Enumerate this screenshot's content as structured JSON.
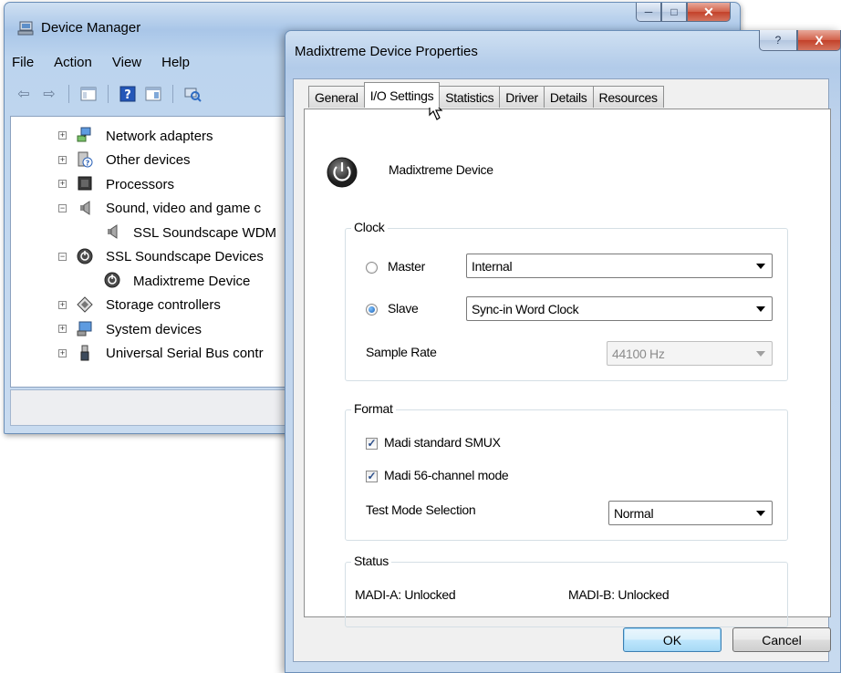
{
  "device_manager": {
    "title": "Device Manager",
    "menu": [
      "File",
      "Action",
      "View",
      "Help"
    ],
    "tree": [
      {
        "label": "Network adapters",
        "icon": "network-icon",
        "expander": "+"
      },
      {
        "label": "Other devices",
        "icon": "unknown-device-icon",
        "expander": "+"
      },
      {
        "label": "Processors",
        "icon": "processor-icon",
        "expander": "+"
      },
      {
        "label": "Sound, video and game c",
        "icon": "speaker-icon",
        "expander": "-"
      },
      {
        "label": "SSL Soundscape WDM",
        "icon": "speaker-icon",
        "expander": ""
      },
      {
        "label": "SSL Soundscape Devices",
        "icon": "power-knob-icon",
        "expander": "-"
      },
      {
        "label": "Madixtreme Device",
        "icon": "power-knob-icon",
        "expander": ""
      },
      {
        "label": "Storage controllers",
        "icon": "storage-icon",
        "expander": "+"
      },
      {
        "label": "System devices",
        "icon": "system-icon",
        "expander": "+"
      },
      {
        "label": "Universal Serial Bus contr",
        "icon": "usb-icon",
        "expander": "+"
      }
    ]
  },
  "properties": {
    "title": "Madixtreme Device Properties",
    "help_glyph": "?",
    "close_glyph": "X",
    "tabs": [
      "General",
      "I/O Settings",
      "Statistics",
      "Driver",
      "Details",
      "Resources"
    ],
    "active_tab": "I/O Settings",
    "device_name": "Madixtreme Device",
    "clock": {
      "title": "Clock",
      "master_label": "Master",
      "master_value": "Internal",
      "slave_label": "Slave",
      "slave_value": "Sync-in Word Clock",
      "selected": "Slave",
      "sample_rate_label": "Sample Rate",
      "sample_rate_value": "44100 Hz"
    },
    "format": {
      "title": "Format",
      "smux_label": "Madi standard SMUX",
      "smux_checked": true,
      "channel_label": "Madi 56-channel mode",
      "channel_checked": true,
      "test_mode_label": "Test Mode Selection",
      "test_mode_value": "Normal"
    },
    "status": {
      "title": "Status",
      "madi_a": "MADI-A:  Unlocked",
      "madi_b": "MADI-B:  Unlocked"
    },
    "ok_label": "OK",
    "cancel_label": "Cancel"
  },
  "colors": {
    "aero_frame": "#b2cbe9",
    "close_red": "#c3412a",
    "radio_blue": "#1a5fb4"
  }
}
